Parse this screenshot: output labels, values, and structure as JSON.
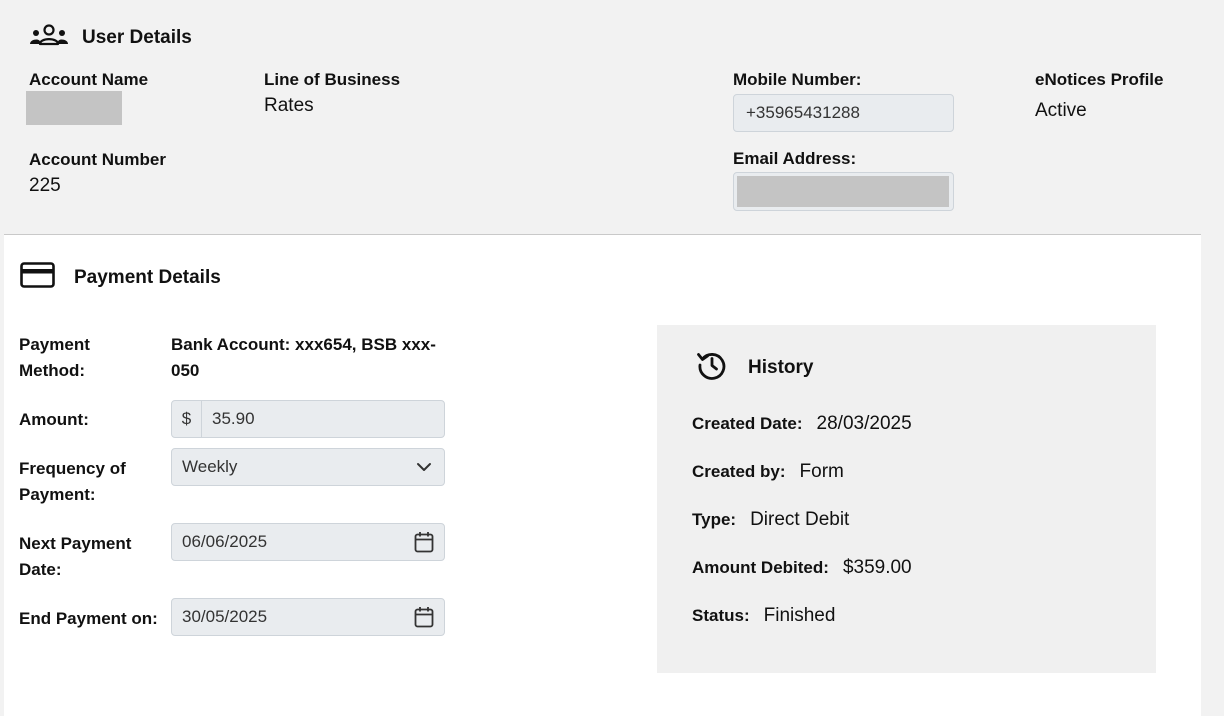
{
  "user_details": {
    "title": "User Details",
    "account_name_label": "Account Name",
    "line_of_business_label": "Line of Business",
    "line_of_business_value": "Rates",
    "mobile_label": "Mobile Number:",
    "mobile_value": "+35965431288",
    "enotices_label": "eNotices Profile",
    "enotices_value": "Active",
    "account_number_label": "Account Number",
    "account_number_value": "225",
    "email_label": "Email Address:"
  },
  "payment_details": {
    "title": "Payment Details",
    "method_label": "Payment Method:",
    "method_value": "Bank Account: xxx654, BSB xxx-050",
    "amount_label": "Amount:",
    "amount_prefix": "$",
    "amount_value": "35.90",
    "frequency_label": "Frequency of Payment:",
    "frequency_value": "Weekly",
    "next_date_label": "Next Payment Date:",
    "next_date_value": "06/06/2025",
    "end_date_label": "End Payment on:",
    "end_date_value": "30/05/2025"
  },
  "history": {
    "title": "History",
    "created_date_label": "Created Date:",
    "created_date_value": "28/03/2025",
    "created_by_label": "Created by:",
    "created_by_value": "Form",
    "type_label": "Type:",
    "type_value": "Direct Debit",
    "amount_debited_label": "Amount Debited:",
    "amount_debited_value": "$359.00",
    "status_label": "Status:",
    "status_value": "Finished"
  },
  "icons": {
    "users": "users-icon",
    "card": "credit-card-icon",
    "history": "history-icon",
    "calendar": "calendar-icon",
    "chevron": "chevron-down-icon"
  }
}
